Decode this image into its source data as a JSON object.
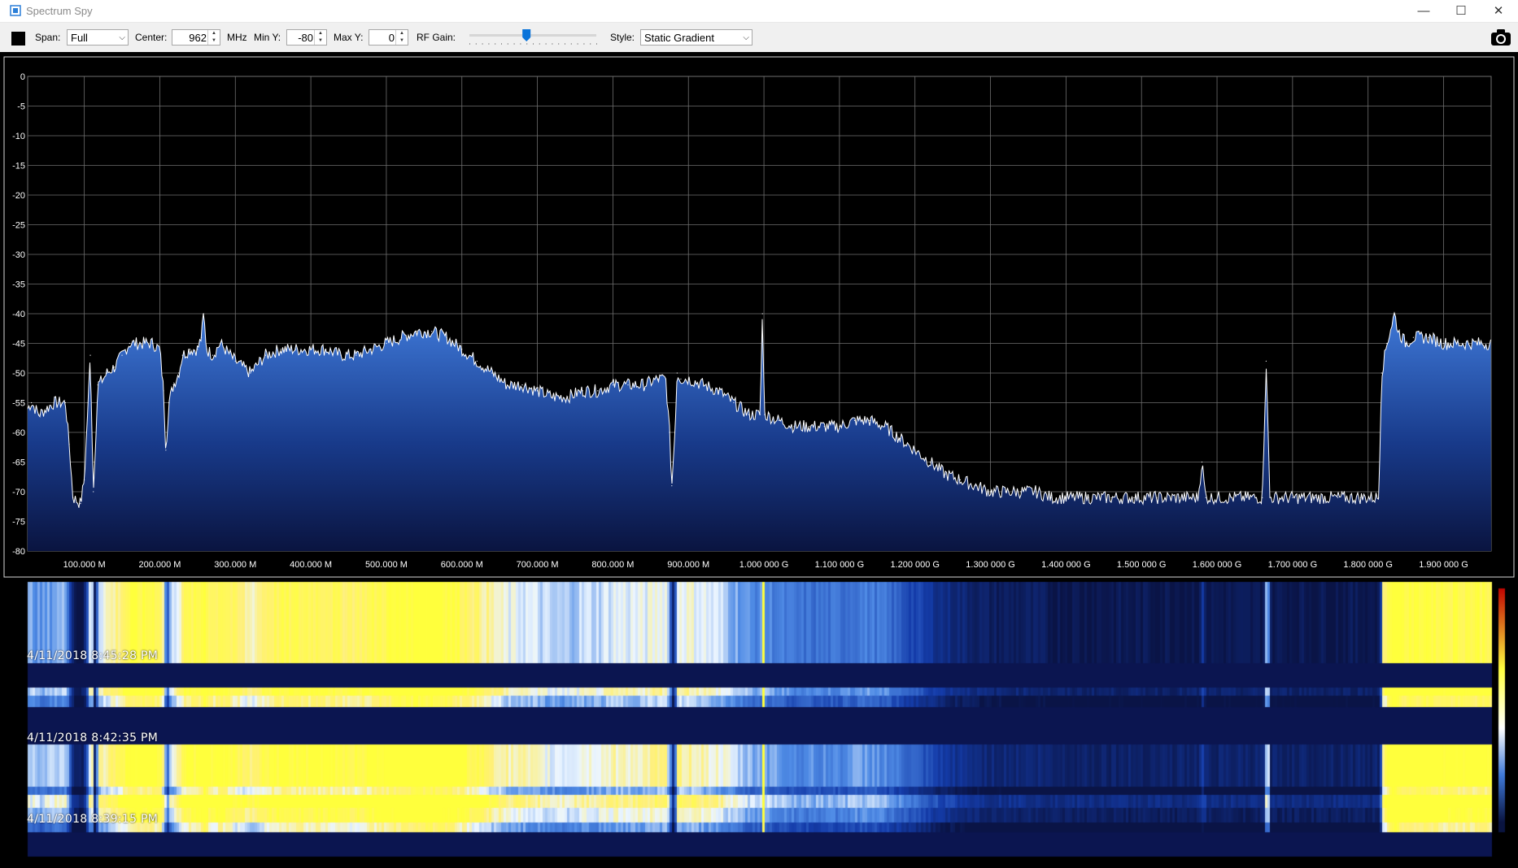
{
  "window": {
    "title": "Spectrum Spy",
    "minimize": "—",
    "maximize": "☐",
    "close": "✕"
  },
  "toolbar": {
    "span_label": "Span:",
    "span_value": "Full",
    "center_label": "Center:",
    "center_value": "962",
    "center_unit": "MHz",
    "miny_label": "Min Y:",
    "miny_value": "-80",
    "maxy_label": "Max Y:",
    "maxy_value": "0",
    "rfgain_label": "RF Gain:",
    "rfgain_level": 0.45,
    "style_label": "Style:",
    "style_value": "Static Gradient"
  },
  "icons": {
    "camera": "camera-icon",
    "app": "app-icon",
    "color": "color-swatch"
  },
  "colors": {
    "trace": "#ffffff",
    "fill_top": "#3f79d8",
    "fill_bottom": "#0a1440",
    "grid": "#6f6f6f",
    "background": "#000000"
  },
  "chart_data": {
    "type": "area",
    "title": "",
    "xlabel": "",
    "ylabel": "",
    "xlim": [
      25,
      1963
    ],
    "ylim": [
      -80,
      0
    ],
    "y_ticks": [
      0,
      -5,
      -10,
      -15,
      -20,
      -25,
      -30,
      -35,
      -40,
      -45,
      -50,
      -55,
      -60,
      -65,
      -70,
      -75,
      -80
    ],
    "x_ticks": [
      {
        "v": 100,
        "label": "100.000 M"
      },
      {
        "v": 200,
        "label": "200.000 M"
      },
      {
        "v": 300,
        "label": "300.000 M"
      },
      {
        "v": 400,
        "label": "400.000 M"
      },
      {
        "v": 500,
        "label": "500.000 M"
      },
      {
        "v": 600,
        "label": "600.000 M"
      },
      {
        "v": 700,
        "label": "700.000 M"
      },
      {
        "v": 800,
        "label": "800.000 M"
      },
      {
        "v": 900,
        "label": "900.000 M"
      },
      {
        "v": 1000,
        "label": "1.000 000 G"
      },
      {
        "v": 1100,
        "label": "1.100 000 G"
      },
      {
        "v": 1200,
        "label": "1.200 000 G"
      },
      {
        "v": 1300,
        "label": "1.300 000 G"
      },
      {
        "v": 1400,
        "label": "1.400 000 G"
      },
      {
        "v": 1500,
        "label": "1.500 000 G"
      },
      {
        "v": 1600,
        "label": "1.600 000 G"
      },
      {
        "v": 1700,
        "label": "1.700 000 G"
      },
      {
        "v": 1800,
        "label": "1.800 000 G"
      },
      {
        "v": 1900,
        "label": "1.900 000 G"
      }
    ],
    "grid": true,
    "series": [
      {
        "points": [
          [
            25,
            -56
          ],
          [
            30,
            -55
          ],
          [
            40,
            -57
          ],
          [
            50,
            -56
          ],
          [
            60,
            -55
          ],
          [
            75,
            -55
          ],
          [
            80,
            -62
          ],
          [
            85,
            -71
          ],
          [
            95,
            -72
          ],
          [
            100,
            -68
          ],
          [
            105,
            -55
          ],
          [
            108,
            -47
          ],
          [
            112,
            -70
          ],
          [
            118,
            -52
          ],
          [
            125,
            -51
          ],
          [
            130,
            -50
          ],
          [
            140,
            -49
          ],
          [
            150,
            -47
          ],
          [
            160,
            -45
          ],
          [
            175,
            -45
          ],
          [
            190,
            -45
          ],
          [
            200,
            -46
          ],
          [
            205,
            -53
          ],
          [
            208,
            -63
          ],
          [
            212,
            -55
          ],
          [
            218,
            -52
          ],
          [
            225,
            -50
          ],
          [
            230,
            -47
          ],
          [
            240,
            -46
          ],
          [
            250,
            -46
          ],
          [
            255,
            -44
          ],
          [
            258,
            -40
          ],
          [
            262,
            -46
          ],
          [
            270,
            -47
          ],
          [
            280,
            -45
          ],
          [
            300,
            -48
          ],
          [
            320,
            -50
          ],
          [
            340,
            -47
          ],
          [
            360,
            -46
          ],
          [
            380,
            -46
          ],
          [
            400,
            -46
          ],
          [
            420,
            -46
          ],
          [
            440,
            -47
          ],
          [
            460,
            -47
          ],
          [
            480,
            -46
          ],
          [
            500,
            -45
          ],
          [
            520,
            -44
          ],
          [
            540,
            -43
          ],
          [
            560,
            -43
          ],
          [
            580,
            -44
          ],
          [
            600,
            -46
          ],
          [
            620,
            -48
          ],
          [
            640,
            -50
          ],
          [
            660,
            -52
          ],
          [
            680,
            -52
          ],
          [
            700,
            -53
          ],
          [
            720,
            -54
          ],
          [
            740,
            -54
          ],
          [
            760,
            -53
          ],
          [
            780,
            -53
          ],
          [
            800,
            -52
          ],
          [
            820,
            -52
          ],
          [
            840,
            -52
          ],
          [
            860,
            -51
          ],
          [
            870,
            -51
          ],
          [
            875,
            -60
          ],
          [
            878,
            -69
          ],
          [
            882,
            -60
          ],
          [
            885,
            -50
          ],
          [
            890,
            -51
          ],
          [
            900,
            -51
          ],
          [
            920,
            -52
          ],
          [
            940,
            -53
          ],
          [
            960,
            -55
          ],
          [
            980,
            -57
          ],
          [
            995,
            -57
          ],
          [
            998,
            -40
          ],
          [
            1001,
            -57
          ],
          [
            1020,
            -58
          ],
          [
            1040,
            -59
          ],
          [
            1060,
            -59
          ],
          [
            1080,
            -59
          ],
          [
            1100,
            -59
          ],
          [
            1120,
            -58
          ],
          [
            1140,
            -58
          ],
          [
            1160,
            -59
          ],
          [
            1180,
            -61
          ],
          [
            1200,
            -63
          ],
          [
            1220,
            -65
          ],
          [
            1240,
            -67
          ],
          [
            1260,
            -68
          ],
          [
            1280,
            -69
          ],
          [
            1300,
            -70
          ],
          [
            1320,
            -70
          ],
          [
            1340,
            -70
          ],
          [
            1360,
            -70
          ],
          [
            1380,
            -71
          ],
          [
            1400,
            -71
          ],
          [
            1430,
            -71
          ],
          [
            1460,
            -71
          ],
          [
            1490,
            -71
          ],
          [
            1520,
            -71
          ],
          [
            1550,
            -71
          ],
          [
            1575,
            -71
          ],
          [
            1580,
            -65
          ],
          [
            1585,
            -71
          ],
          [
            1620,
            -71
          ],
          [
            1660,
            -71
          ],
          [
            1665,
            -48
          ],
          [
            1670,
            -71
          ],
          [
            1700,
            -71
          ],
          [
            1730,
            -71
          ],
          [
            1760,
            -71
          ],
          [
            1790,
            -71
          ],
          [
            1814,
            -71
          ],
          [
            1818,
            -50
          ],
          [
            1825,
            -45
          ],
          [
            1835,
            -40
          ],
          [
            1840,
            -43
          ],
          [
            1850,
            -45
          ],
          [
            1860,
            -44
          ],
          [
            1880,
            -44
          ],
          [
            1900,
            -45
          ],
          [
            1925,
            -45
          ]
        ]
      }
    ]
  },
  "waterfall": {
    "timestamps": [
      "4/11/2018 8:45:28 PM",
      "4/11/2018 8:42:35 PM",
      "4/11/2018 8:39:15 PM"
    ]
  }
}
